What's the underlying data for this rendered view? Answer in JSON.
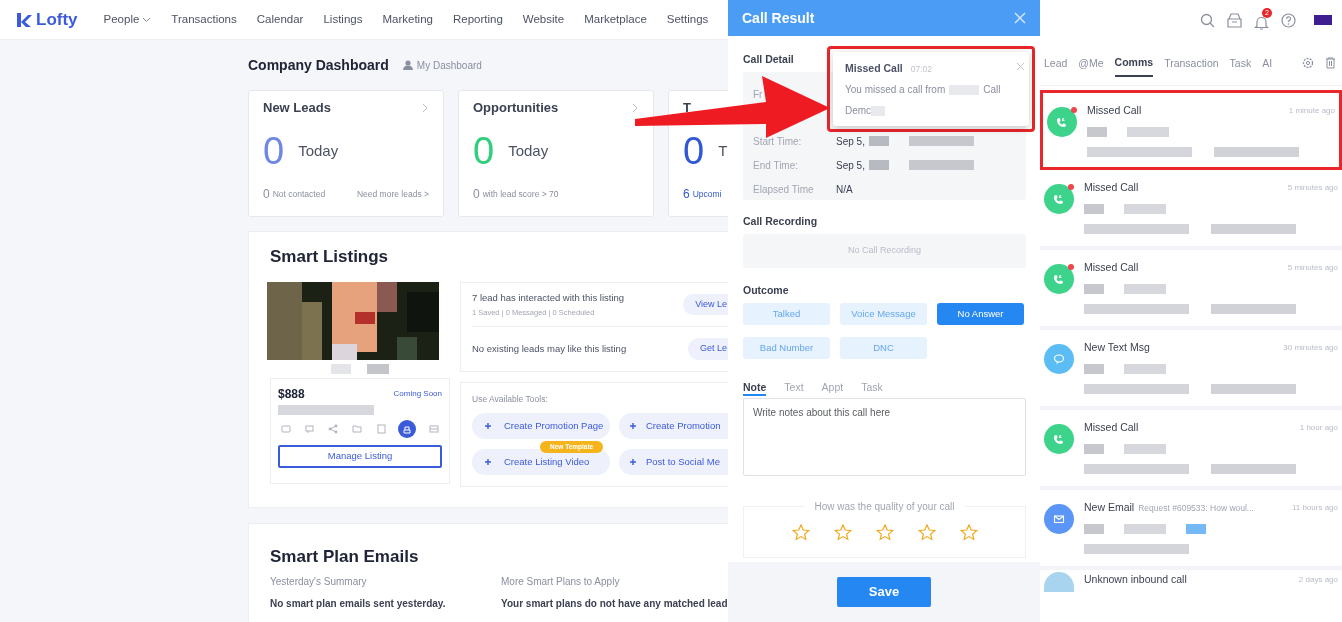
{
  "nav": {
    "logo": "Lofty",
    "items": [
      {
        "label": "People",
        "dropdown": true
      },
      {
        "label": "Transactions",
        "dropdown": false
      },
      {
        "label": "Calendar",
        "dropdown": false
      },
      {
        "label": "Listings",
        "dropdown": false
      },
      {
        "label": "Marketing",
        "dropdown": false
      },
      {
        "label": "Reporting",
        "dropdown": false
      },
      {
        "label": "Website",
        "dropdown": false
      },
      {
        "label": "Marketplace",
        "dropdown": false
      },
      {
        "label": "Settings",
        "dropdown": false
      }
    ]
  },
  "dashboard": {
    "title": "Company Dashboard",
    "switch_link": "My Dashboard",
    "cards": [
      {
        "title": "New Leads",
        "count": "0",
        "color": "#6f88e6",
        "unit": "Today",
        "footer_count": "0",
        "footer_text": "Not contacted",
        "footer_link": "Need more leads >"
      },
      {
        "title": "Opportunities",
        "count": "0",
        "color": "#2fcf7c",
        "unit": "Today",
        "footer_count": "0",
        "footer_text": "with lead score > 70"
      },
      {
        "title": "T",
        "count": "0",
        "color": "#3358d4",
        "unit": "T",
        "footer_count": "6",
        "footer_text": "Upcomi"
      }
    ]
  },
  "smart_listings": {
    "title": "Smart Listings",
    "price": "$888",
    "status": "Coming Soon",
    "manage_button": "Manage Listing",
    "actions": [
      {
        "selected": false
      },
      {
        "selected": false
      },
      {
        "selected": false
      },
      {
        "selected": false
      },
      {
        "selected": false
      },
      {
        "selected": true
      },
      {
        "selected": false
      }
    ],
    "insights": [
      {
        "text": "7 lead has interacted with this listing",
        "subtext": "1 Saved | 0 Messaged | 0 Scheduled",
        "button": "View Le"
      },
      {
        "text": "No existing leads may like this listing",
        "button": "Get Le"
      }
    ],
    "tools_label": "Use Available Tools:",
    "tools": [
      {
        "label": "Create Promotion Page"
      },
      {
        "label": "Create Promotion"
      },
      {
        "label": "Create Listing Video",
        "badge": "New Template"
      },
      {
        "label": "Post to Social Me"
      }
    ]
  },
  "smart_plan": {
    "title": "Smart Plan Emails",
    "columns": [
      {
        "heading": "Yesterday's Summary",
        "text": "No smart plan emails sent yesterday."
      },
      {
        "heading": "More Smart Plans to Apply",
        "text": "Your smart plans do not have any matched lead"
      }
    ]
  },
  "call_result": {
    "title": "Call Result",
    "detail_label": "Call Detail",
    "fields": [
      {
        "label": "Fr"
      },
      {
        "label": "Start Time:",
        "value": "Sep 5,"
      },
      {
        "label": "End Time:",
        "value": "Sep 5,"
      },
      {
        "label": "Elapsed Time",
        "value": "N/A"
      }
    ],
    "recording_label": "Call Recording",
    "recording_empty": "No Call Recording",
    "outcome_label": "Outcome",
    "outcomes": [
      {
        "label": "Talked",
        "selected": false
      },
      {
        "label": "Voice Message",
        "selected": false
      },
      {
        "label": "No Answer",
        "selected": true
      },
      {
        "label": "Bad Number",
        "selected": false
      },
      {
        "label": "DNC",
        "selected": false
      }
    ],
    "note_tabs": [
      {
        "label": "Note",
        "selected": true
      },
      {
        "label": "Text",
        "selected": false
      },
      {
        "label": "Appt",
        "selected": false
      },
      {
        "label": "Task",
        "selected": false
      }
    ],
    "note_placeholder": "Write notes about this call here",
    "quality_prompt": "How was the quality of your call",
    "stars": 0,
    "save_button": "Save"
  },
  "notification": {
    "title": "Missed Call",
    "time": "07:02",
    "message_start": "You missed a call from",
    "message_mid": "Call",
    "message_end": "Demc",
    "highlighted": true
  },
  "header_icons": {
    "notification_count": "2"
  },
  "comms": {
    "tabs": [
      {
        "label": "Lead",
        "selected": false
      },
      {
        "label": "@Me",
        "selected": false
      },
      {
        "label": "Comms",
        "selected": true
      },
      {
        "label": "Transaction",
        "selected": false
      },
      {
        "label": "Task",
        "selected": false
      },
      {
        "label": "AI",
        "selected": false
      }
    ],
    "items": [
      {
        "kind": "call",
        "title": "Missed Call",
        "time": "1 minute ago",
        "unread": true,
        "highlighted": true
      },
      {
        "kind": "call",
        "title": "Missed Call",
        "time": "5 minutes ago",
        "unread": true,
        "highlighted": false
      },
      {
        "kind": "call",
        "title": "Missed Call",
        "time": "5 minutes ago",
        "unread": true,
        "highlighted": false
      },
      {
        "kind": "text",
        "title": "New Text Msg",
        "time": "30 minutes ago",
        "unread": false,
        "highlighted": false
      },
      {
        "kind": "call",
        "title": "Missed Call",
        "time": "1 hour ago",
        "unread": false,
        "highlighted": false
      },
      {
        "kind": "email",
        "title": "New Email",
        "subject": "Request #609533: How woul...",
        "time": "11 hours ago",
        "unread": false,
        "highlighted": false
      },
      {
        "kind": "unknown",
        "title": "Unknown inbound call",
        "time": "2 days ago",
        "unread": false,
        "highlighted": false
      }
    ]
  }
}
